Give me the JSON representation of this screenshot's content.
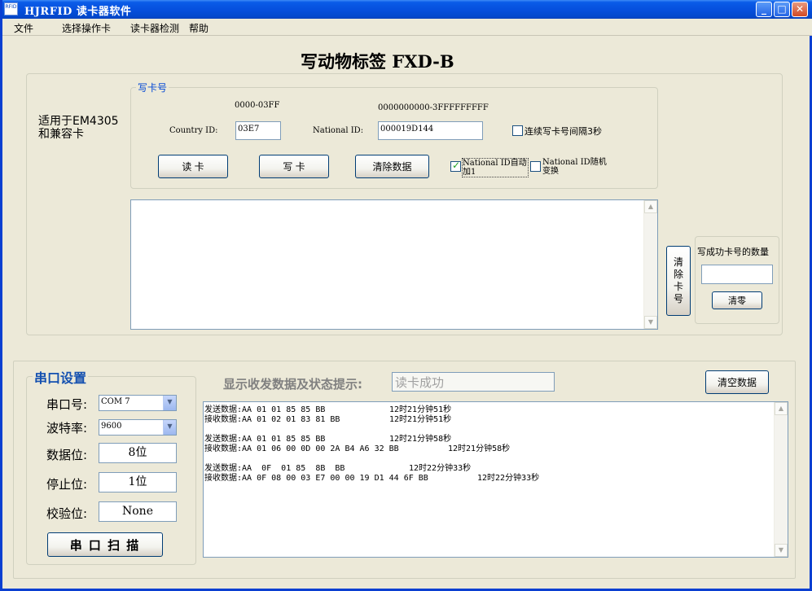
{
  "window": {
    "app_icon_text": "RFID",
    "title": "HJRFID 读卡器软件",
    "buttons": {
      "minimize": "_",
      "maximize": "□",
      "close": "✕"
    }
  },
  "menu": [
    "文件",
    "选择操作卡",
    "读卡器检测",
    "帮助"
  ],
  "main_title": "写动物标签 FXD-B",
  "compat_label": "适用于EM4305和兼容卡",
  "write_group": {
    "legend": "写卡号",
    "country_range": "0000-03FF",
    "national_range": "0000000000-3FFFFFFFFF",
    "country_label": "Country ID:",
    "country_value": "03E7",
    "national_label": "National ID:",
    "national_value": "000019D144",
    "continuous_write_label": "连续写卡号间隔3秒",
    "continuous_write_checked": false,
    "read_button": "读 卡",
    "write_button": "写 卡",
    "clear_data_button": "清除数据",
    "auto_inc_label": "National ID自动加1",
    "auto_inc_checked": true,
    "random_label": "National ID随机变换",
    "random_checked": false
  },
  "clear_card_button": "清除卡号",
  "success_count": {
    "label": "写成功卡号的数量",
    "value": "",
    "reset_button": "清零"
  },
  "serial": {
    "legend": "串口设置",
    "port_label": "串口号:",
    "port_value": "COM 7",
    "baud_label": "波特率:",
    "baud_value": "9600",
    "databits_label": "数据位:",
    "databits_value": "8位",
    "stopbits_label": "停止位:",
    "stopbits_value": "1位",
    "parity_label": "校验位:",
    "parity_value": "None",
    "scan_button": "串 口 扫 描"
  },
  "status": {
    "label": "显示收发数据及状态提示:",
    "value": "读卡成功",
    "clear_button": "清空数据"
  },
  "log": [
    {
      "text": "发送数据:AA 01 01 85 85 BB",
      "time": "12时21分钟51秒"
    },
    {
      "text": "接收数据:AA 01 02 01 83 81 BB",
      "time": "12时21分钟51秒"
    },
    {
      "text": "发送数据:AA 01 01 85 85 BB",
      "time": "12时21分钟58秒"
    },
    {
      "text": "接收数据:AA 01 06 00 0D 00 2A B4 A6 32 BB",
      "time": "12时21分钟58秒"
    },
    {
      "text": "发送数据:AA  0F  01 85  8B  BB",
      "time": "12时22分钟33秒"
    },
    {
      "text": "接收数据:AA 0F 08 00 03 E7 00 00 19 D1 44 6F BB",
      "time": "12时22分钟33秒"
    }
  ],
  "icons": {
    "scroll_up": "▲",
    "scroll_down": "▼",
    "dropdown": "▼"
  }
}
